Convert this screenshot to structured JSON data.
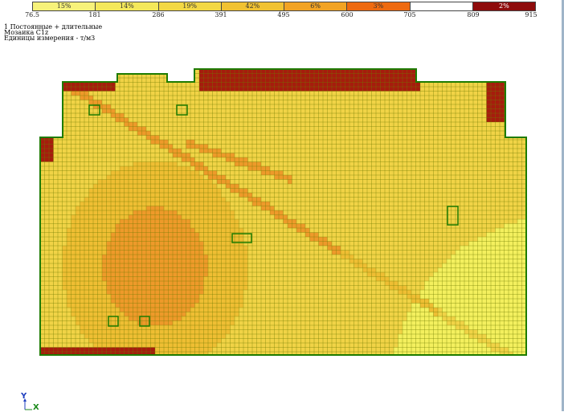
{
  "legend": {
    "segments": [
      {
        "label": "15%",
        "color": "#f7f27a"
      },
      {
        "label": "14%",
        "color": "#f4e85a"
      },
      {
        "label": "19%",
        "color": "#f3d844"
      },
      {
        "label": "42%",
        "color": "#f1c232"
      },
      {
        "label": "6%",
        "color": "#f2a324"
      },
      {
        "label": "3%",
        "color": "#ee6a10"
      },
      {
        "label": "",
        "color": "#ffffff"
      },
      {
        "label": "2%",
        "color": "#8e0b0b"
      }
    ],
    "ticks": [
      "76.5",
      "181",
      "286",
      "391",
      "495",
      "600",
      "705",
      "809",
      "915"
    ]
  },
  "info": {
    "line1": "1 Постоянные + длительные",
    "line2": "Мозаика С1z",
    "line3": "Единицы измерения - т/м3"
  },
  "axes": {
    "y_label": "Y",
    "x_label": "X"
  },
  "colors": {
    "outline": "#1e7b00",
    "grid_line": "#6f7d00",
    "cell_light": "#f4f05e",
    "cell_mid": "#f1d346",
    "cell_warm": "#efbe33",
    "cell_orange": "#ee9a2a",
    "cell_dark": "#a61c0d"
  }
}
